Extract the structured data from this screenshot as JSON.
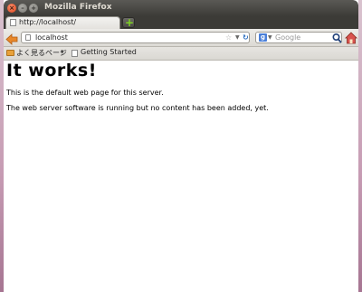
{
  "window": {
    "title": "Mozilla Firefox"
  },
  "tabs": [
    {
      "label": "http://localhost/",
      "active": true
    }
  ],
  "navbar": {
    "url": "localhost",
    "search_placeholder": "Google",
    "search_engine_icon": "google-icon"
  },
  "bookmarks": {
    "folder_label": "よく見るページ",
    "page_label": "Getting Started"
  },
  "page": {
    "heading": "It works!",
    "paragraph1": "This is the default web page for this server.",
    "paragraph2": "The web server software is running but no content has been added, yet."
  },
  "colors": {
    "titlebar": "#3c3b37",
    "close_button": "#e2461b",
    "desktop_accent": "#c69bb3"
  }
}
